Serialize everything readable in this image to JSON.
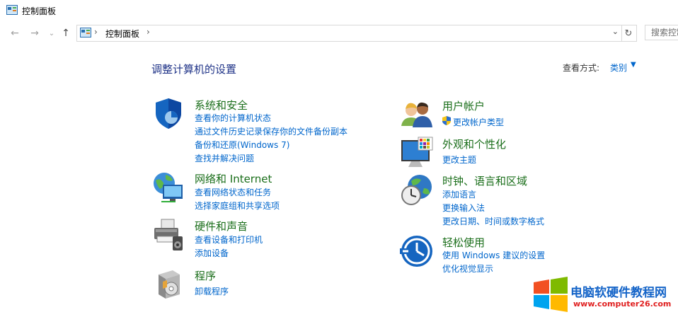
{
  "window": {
    "title": "控制面板"
  },
  "nav": {
    "back": "←",
    "forward": "→",
    "recent": "⌄",
    "up": "↑",
    "address_sep": "›",
    "address_crumb": "控制面板",
    "address_sep2": "›",
    "dropdown": "⌄",
    "refresh": "↻",
    "search_placeholder": "搜索控制面板"
  },
  "header": {
    "title": "调整计算机的设置",
    "view_by_label": "查看方式:",
    "view_by_value": "类别",
    "view_by_arrow": "▼"
  },
  "categories": {
    "security": {
      "title": "系统和安全",
      "links": [
        "查看你的计算机状态",
        "通过文件历史记录保存你的文件备份副本",
        "备份和还原(Windows 7)",
        "查找并解决问题"
      ]
    },
    "network": {
      "title": "网络和 Internet",
      "links": [
        "查看网络状态和任务",
        "选择家庭组和共享选项"
      ]
    },
    "hardware": {
      "title": "硬件和声音",
      "links": [
        "查看设备和打印机",
        "添加设备"
      ]
    },
    "programs": {
      "title": "程序",
      "links": [
        "卸载程序"
      ]
    },
    "users": {
      "title": "用户帐户",
      "links": [
        "更改帐户类型"
      ]
    },
    "appearance": {
      "title": "外观和个性化",
      "links": [
        "更改主题"
      ]
    },
    "clock": {
      "title": "时钟、语言和区域",
      "links": [
        "添加语言",
        "更换输入法",
        "更改日期、时间或数字格式"
      ]
    },
    "ease": {
      "title": "轻松使用",
      "links": [
        "使用 Windows 建议的设置",
        "优化视觉显示"
      ]
    }
  },
  "watermark": {
    "title": "电脑软硬件教程网",
    "url": "www.computer26.com"
  },
  "colors": {
    "link": "#0066cc",
    "category_title": "#1a6e1a",
    "heading": "#1e3287"
  }
}
